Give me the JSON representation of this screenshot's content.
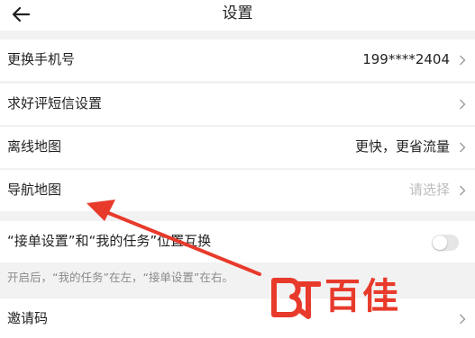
{
  "header": {
    "title": "设置",
    "back_icon": "back-arrow-icon"
  },
  "rows": {
    "phone": {
      "label": "更换手机号",
      "value": "199****2404"
    },
    "sms": {
      "label": "求好评短信设置"
    },
    "offline_map": {
      "label": "离线地图",
      "value": "更快，更省流量"
    },
    "nav_map": {
      "label": "导航地图",
      "value": "请选择"
    },
    "swap": {
      "label": "“接单设置”和“我的任务”位置互换",
      "toggle_on": false
    },
    "invite": {
      "label": "邀请码"
    }
  },
  "hint": {
    "text": "开启后，“我的任务”在左，“接单设置”在右。"
  },
  "colors": {
    "accent_red": "#e83a2b",
    "background": "#f2f2f2",
    "placeholder": "#bdbdbd"
  },
  "watermark": {
    "text": "百佳"
  }
}
